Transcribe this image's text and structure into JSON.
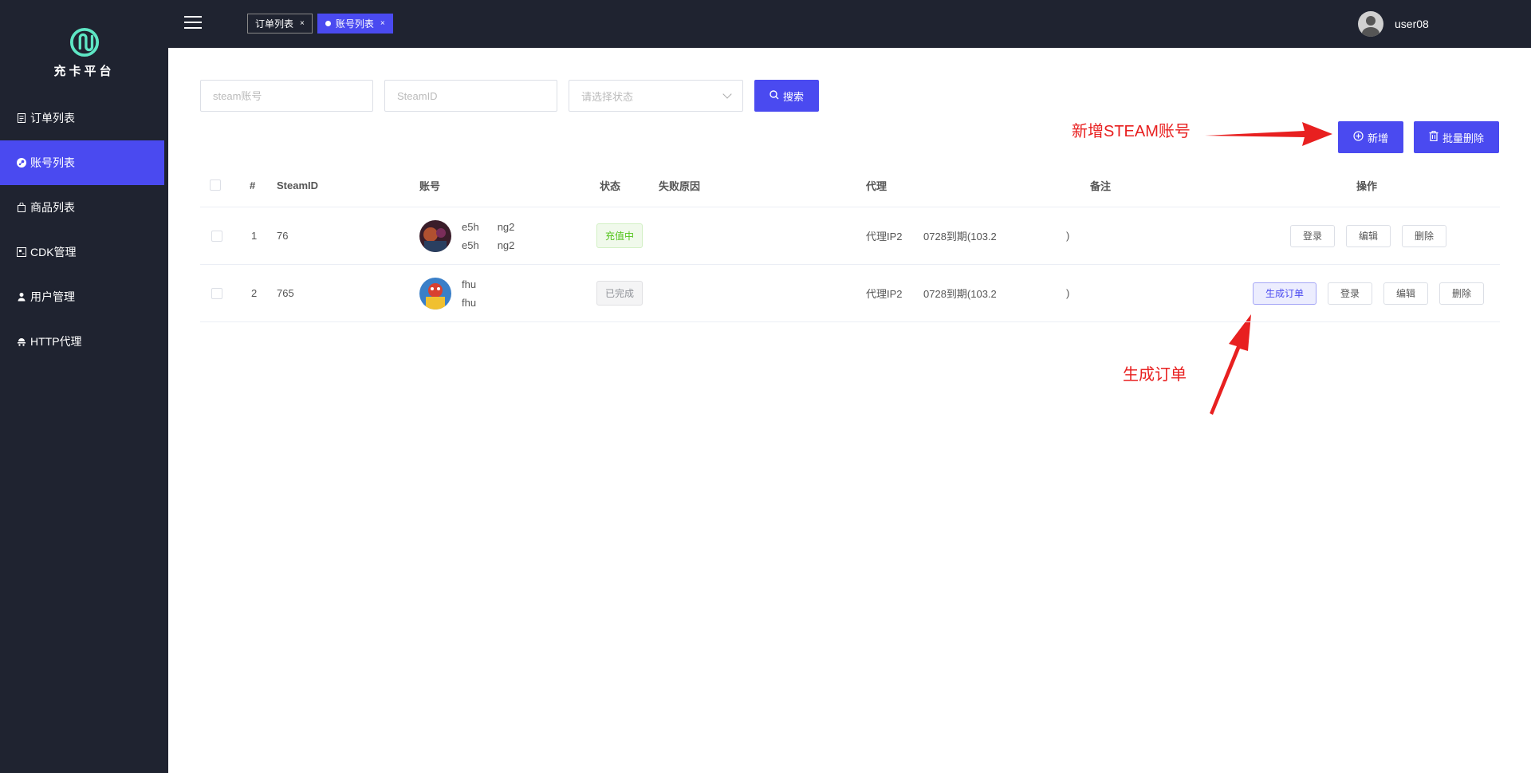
{
  "sidebar": {
    "logo_text": "充卡平台",
    "items": [
      {
        "label": "订单列表",
        "icon": "document-icon"
      },
      {
        "label": "账号列表",
        "icon": "steam-icon",
        "active": true
      },
      {
        "label": "商品列表",
        "icon": "bag-icon"
      },
      {
        "label": "CDK管理",
        "icon": "cdk-icon"
      },
      {
        "label": "用户管理",
        "icon": "user-icon"
      },
      {
        "label": "HTTP代理",
        "icon": "proxy-icon"
      }
    ]
  },
  "topbar": {
    "tabs": [
      {
        "label": "订单列表",
        "close": "×",
        "active": false
      },
      {
        "label": "账号列表",
        "close": "×",
        "active": true
      }
    ],
    "username": "user08"
  },
  "filters": {
    "steam_account_placeholder": "steam账号",
    "steamid_placeholder": "SteamID",
    "status_placeholder": "请选择状态",
    "search_label": "搜索"
  },
  "actions": {
    "add_label": "新增",
    "batch_delete_label": "批量删除"
  },
  "annotations": {
    "add_note": "新增STEAM账号",
    "order_note": "生成订单"
  },
  "table": {
    "headers": {
      "index": "#",
      "steamid": "SteamID",
      "account": "账号",
      "status": "状态",
      "fail_reason": "失败原因",
      "proxy": "代理",
      "remark": "备注",
      "ops": "操作"
    },
    "rows": [
      {
        "index": "1",
        "steamid": "76",
        "account_line1": "e5h",
        "account_line1_tail": "ng2",
        "account_line2": "e5h",
        "account_line2_tail": "ng2",
        "status": "充值中",
        "proxy_name": "代理IP2",
        "proxy_detail": "0728到期(103.2",
        "proxy_tail": ")",
        "buttons": [
          "登录",
          "编辑",
          "删除"
        ]
      },
      {
        "index": "2",
        "steamid": "765",
        "account_line1": "fhu",
        "account_line1_tail": "",
        "account_line2": "fhu",
        "account_line2_tail": "",
        "status": "已完成",
        "proxy_name": "代理IP2",
        "proxy_detail": "0728到期(103.2",
        "proxy_tail": ")",
        "buttons": [
          "生成订单",
          "登录",
          "编辑",
          "删除"
        ]
      }
    ]
  },
  "colors": {
    "sidebar_bg": "#1f2330",
    "accent": "#4a4af0",
    "annotation": "#e82020"
  }
}
